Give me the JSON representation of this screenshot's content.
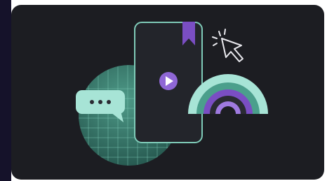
{
  "illustration": {
    "colors": {
      "page_edge": "#15122a",
      "card_background": "#1c1d22",
      "accent_teal": "#a7e4d6",
      "accent_teal_dark": "#4b9f8c",
      "accent_purple": "#7a4ec3",
      "accent_purple_light": "#9f7ae0",
      "phone_body": "#23252b",
      "phone_outline": "#7fcbb8"
    },
    "icons": [
      "globe-grid-icon",
      "chat-bubble-icon",
      "phone-icon",
      "bookmark-icon",
      "play-icon",
      "rainbow-arcs-icon",
      "cursor-click-icon"
    ]
  }
}
